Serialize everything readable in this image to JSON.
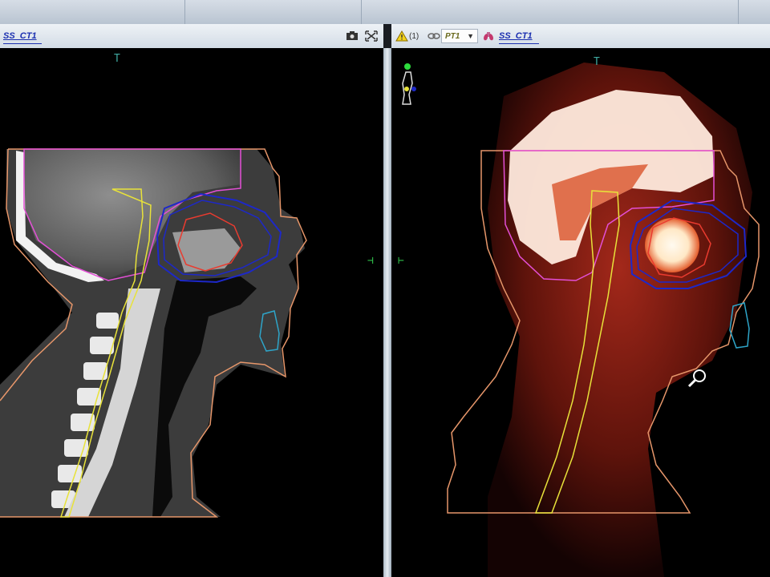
{
  "window": {
    "left_tab": "SS_CT1",
    "right_primary": "PT1",
    "right_secondary": "SS_CT1",
    "warning_count": "(1)"
  },
  "icons": {
    "capture": "camera-icon",
    "maximize": "expand-icon",
    "warning": "warning-icon",
    "link": "link-icon",
    "lungs": "lungs-icon",
    "dropdown": "chevron-down-icon",
    "orientation": "body-orientation-icon",
    "magnifier": "zoom-icon"
  },
  "markers": {
    "top_left": "T",
    "top_right": "T",
    "cross_left": "⊢",
    "cross_right": "⊣"
  },
  "colors": {
    "body_contour": "#e6966a",
    "brain_contour": "#e34fd6",
    "spinal_cord": "#e8e23a",
    "ptv_outer": "#1d28c9",
    "gtv": "#ea3b2f",
    "oral_cavity": "#2ea5c9",
    "pet_hot": "#fff4d8"
  }
}
